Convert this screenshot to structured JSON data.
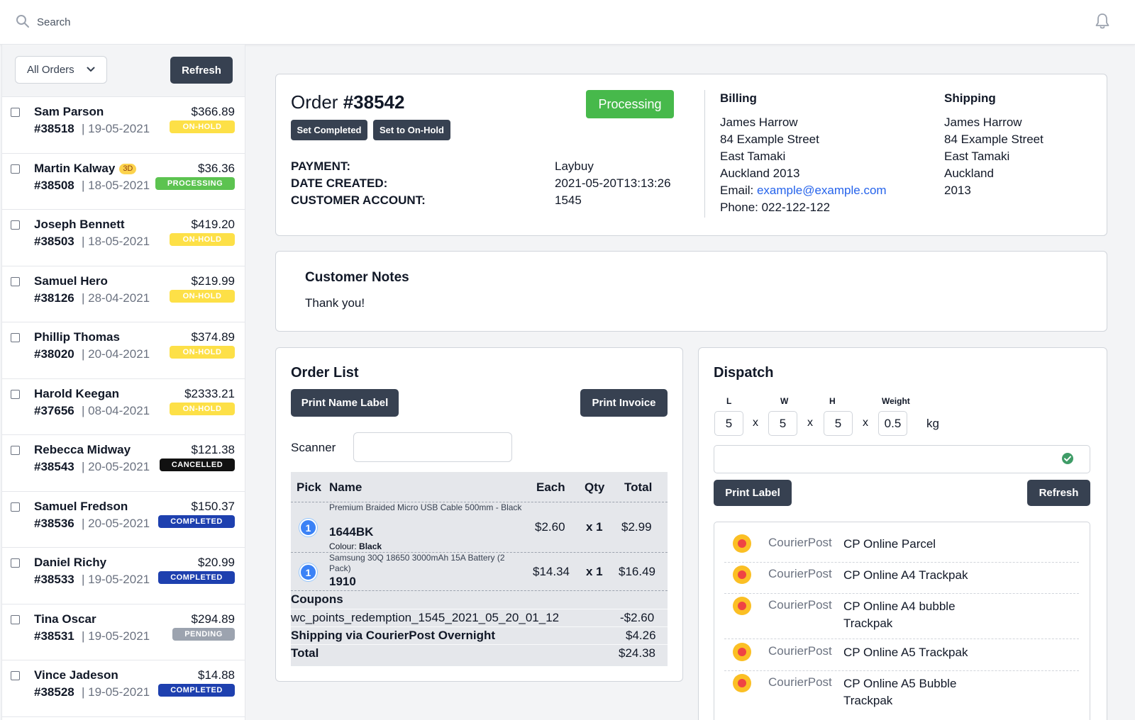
{
  "topbar": {
    "search_placeholder": "Search"
  },
  "sidebar": {
    "filter_label": "All Orders",
    "refresh_label": "Refresh",
    "orders": [
      {
        "name": "Sam Parson",
        "number": "#38518",
        "date": "19-05-2021",
        "price": "$366.89",
        "status": "ON-HOLD",
        "tag": ""
      },
      {
        "name": "Martin Kalway",
        "number": "#38508",
        "date": "18-05-2021",
        "price": "$36.36",
        "status": "PROCESSING",
        "tag": "3D"
      },
      {
        "name": "Joseph Bennett",
        "number": "#38503",
        "date": "18-05-2021",
        "price": "$419.20",
        "status": "ON-HOLD",
        "tag": ""
      },
      {
        "name": "Samuel Hero",
        "number": "#38126",
        "date": "28-04-2021",
        "price": "$219.99",
        "status": "ON-HOLD",
        "tag": ""
      },
      {
        "name": "Phillip Thomas",
        "number": "#38020",
        "date": "20-04-2021",
        "price": "$374.89",
        "status": "ON-HOLD",
        "tag": ""
      },
      {
        "name": "Harold Keegan",
        "number": "#37656",
        "date": "08-04-2021",
        "price": "$2333.21",
        "status": "ON-HOLD",
        "tag": ""
      },
      {
        "name": "Rebecca Midway",
        "number": "#38543",
        "date": "20-05-2021",
        "price": "$121.38",
        "status": "CANCELLED",
        "tag": ""
      },
      {
        "name": "Samuel Fredson",
        "number": "#38536",
        "date": "20-05-2021",
        "price": "$150.37",
        "status": "COMPLETED",
        "tag": ""
      },
      {
        "name": "Daniel Richy",
        "number": "#38533",
        "date": "19-05-2021",
        "price": "$20.99",
        "status": "COMPLETED",
        "tag": ""
      },
      {
        "name": "Tina Oscar",
        "number": "#38531",
        "date": "19-05-2021",
        "price": "$294.89",
        "status": "PENDING",
        "tag": ""
      },
      {
        "name": "Vince Jadeson",
        "number": "#38528",
        "date": "19-05-2021",
        "price": "$14.88",
        "status": "COMPLETED",
        "tag": ""
      }
    ]
  },
  "order": {
    "title_prefix": "Order ",
    "number": "#38542",
    "status": "Processing",
    "set_completed": "Set Completed",
    "set_onhold": "Set to On-Hold",
    "fields": [
      {
        "key": "PAYMENT:",
        "value": "Laybuy"
      },
      {
        "key": "DATE CREATED:",
        "value": "2021-05-20T13:13:26"
      },
      {
        "key": "CUSTOMER ACCOUNT:",
        "value": "1545"
      }
    ],
    "billing": {
      "heading": "Billing",
      "lines": [
        "James Harrow",
        "84 Example Street",
        "East Tamaki",
        "Auckland 2013"
      ],
      "email_label": "Email: ",
      "email": "example@example.com",
      "phone": "Phone: 022-122-122"
    },
    "shipping": {
      "heading": "Shipping",
      "lines": [
        "James Harrow",
        "84 Example Street",
        "East Tamaki",
        "Auckland",
        "2013"
      ]
    }
  },
  "notes": {
    "heading": "Customer Notes",
    "text": "Thank you!"
  },
  "order_list": {
    "heading": "Order List",
    "print_name_label": "Print Name Label",
    "print_invoice": "Print Invoice",
    "scanner_label": "Scanner",
    "columns": [
      "Pick",
      "Name",
      "Each",
      "Qty",
      "Total"
    ],
    "items": [
      {
        "pick": "1",
        "name": "Premium Braided Micro USB Cable 500mm - Black",
        "sku": "1644BK",
        "colour_label": "Colour: ",
        "colour": "Black",
        "each": "$2.60",
        "qty": "x 1",
        "total": "$2.99"
      },
      {
        "pick": "1",
        "name": "Samsung 30Q 18650 3000mAh 15A Battery (2 Pack)",
        "sku": "1910",
        "colour_label": "",
        "colour": "",
        "each": "$14.34",
        "qty": "x 1",
        "total": "$16.49"
      }
    ],
    "coupons_label": "Coupons",
    "coupon_code": "wc_points_redemption_1545_2021_05_20_01_12",
    "coupon_value": "-$2.60",
    "shipping_label": "Shipping via CourierPost Overnight",
    "shipping_value": "$4.26",
    "total_label": "Total",
    "total_value": "$24.38"
  },
  "dispatch": {
    "heading": "Dispatch",
    "dims": [
      {
        "label": "L",
        "value": "5"
      },
      {
        "label": "W",
        "value": "5"
      },
      {
        "label": "H",
        "value": "5"
      },
      {
        "label": "Weight",
        "value": "0.5"
      }
    ],
    "times": "x",
    "unit": "kg",
    "print_label": "Print Label",
    "refresh_label": "Refresh",
    "services": [
      {
        "carrier": "CourierPost",
        "name": "CP Online Parcel"
      },
      {
        "carrier": "CourierPost",
        "name": "CP Online A4 Trackpak"
      },
      {
        "carrier": "CourierPost",
        "name": "CP Online A4 bubble Trackpak"
      },
      {
        "carrier": "CourierPost",
        "name": "CP Online A5 Trackpak"
      },
      {
        "carrier": "CourierPost",
        "name": "CP Online A5 Bubble Trackpak"
      }
    ]
  }
}
